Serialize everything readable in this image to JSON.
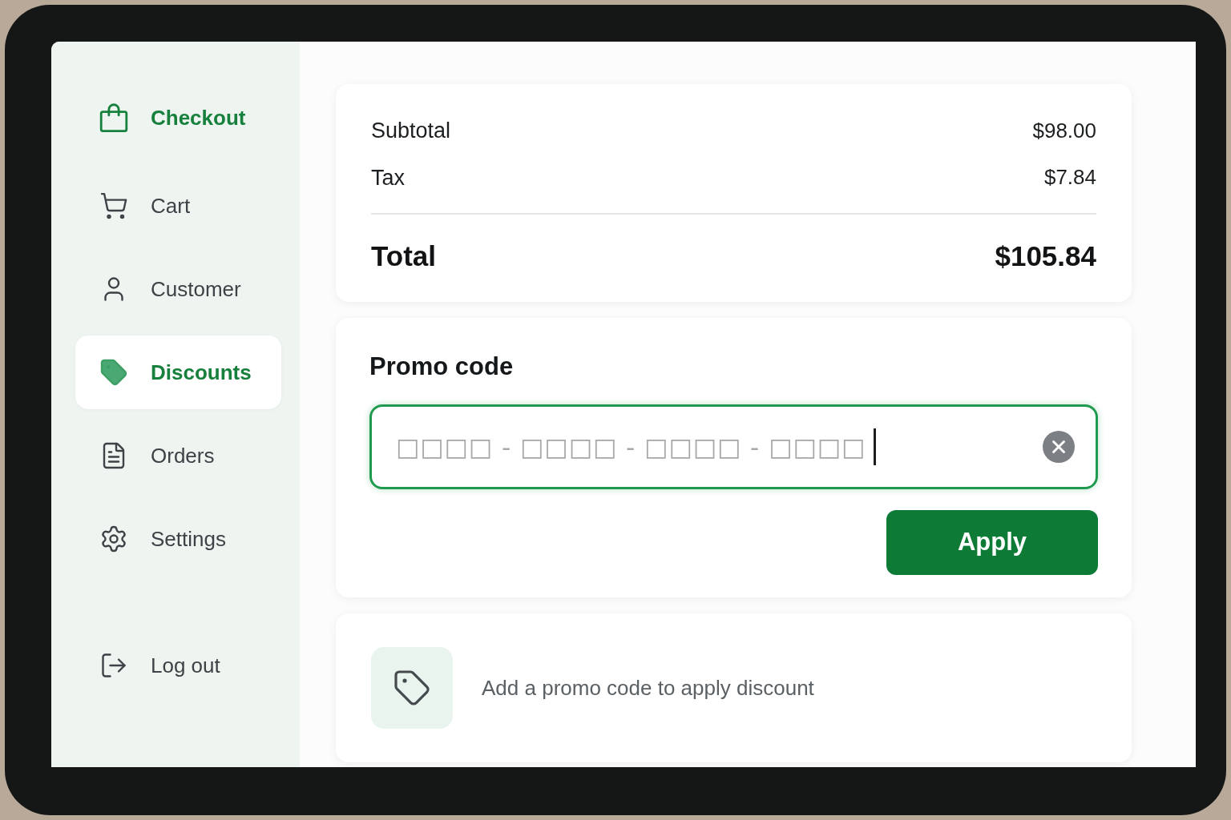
{
  "sidebar": {
    "header": {
      "label": "Checkout"
    },
    "items": [
      {
        "label": "Cart",
        "selected": false
      },
      {
        "label": "Customer",
        "selected": false
      },
      {
        "label": "Discounts",
        "selected": true
      },
      {
        "label": "Orders",
        "selected": false
      },
      {
        "label": "Settings",
        "selected": false
      }
    ],
    "footer": {
      "label": "Log out"
    }
  },
  "summary": {
    "rows": [
      {
        "label": "Subtotal",
        "value": "$98.00"
      },
      {
        "label": "Tax",
        "value": "$7.84"
      }
    ],
    "total": {
      "label": "Total",
      "value": "$105.84"
    }
  },
  "promo": {
    "title": "Promo code",
    "input": {
      "placeholder": "□□□□ - □□□□ - □□□□ - □□□□",
      "focused": true
    },
    "button": "Apply"
  },
  "hint": {
    "text": "Add a promo code to apply discount"
  }
}
